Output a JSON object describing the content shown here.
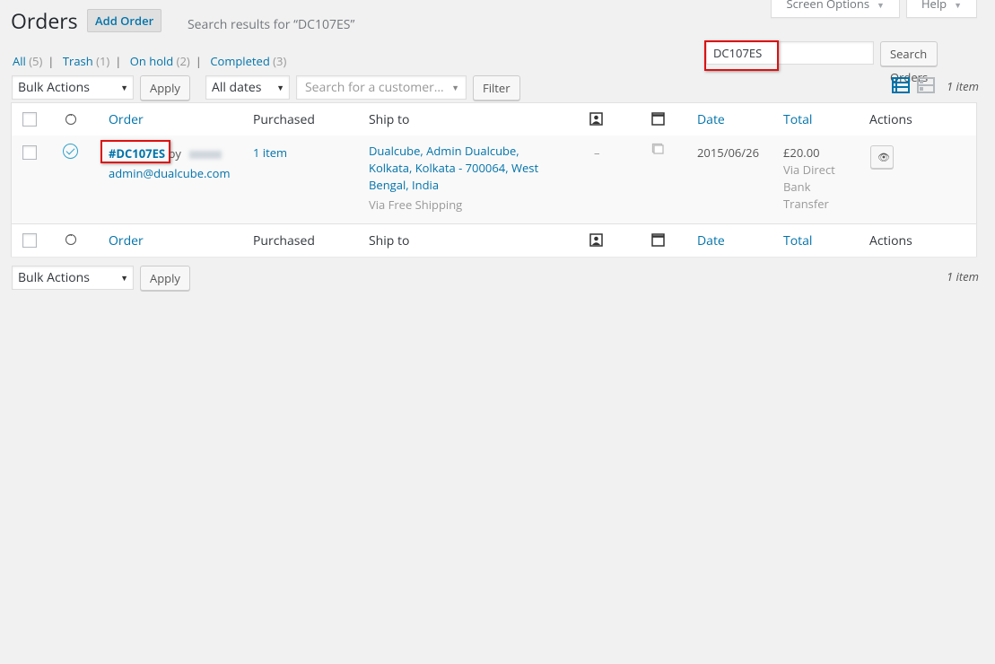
{
  "screen_meta": {
    "screen_options": "Screen Options",
    "help": "Help"
  },
  "header": {
    "title": "Orders",
    "add_order": "Add Order",
    "search_results": "Search results for “DC107ES”"
  },
  "filters": [
    {
      "label": "All",
      "count": "(5)"
    },
    {
      "label": "Trash",
      "count": "(1)"
    },
    {
      "label": "On hold",
      "count": "(2)"
    },
    {
      "label": "Completed",
      "count": "(3)"
    }
  ],
  "search": {
    "value": "DC107ES",
    "button": "Search Orders"
  },
  "top_nav": {
    "bulk_actions": "Bulk Actions",
    "apply": "Apply",
    "dates": "All dates",
    "customer_placeholder": "Search for a customer…",
    "filter": "Filter",
    "items_count": "1 item"
  },
  "columns": {
    "order": "Order",
    "purchased": "Purchased",
    "ship_to": "Ship to",
    "date": "Date",
    "total": "Total",
    "actions": "Actions"
  },
  "order_row": {
    "order_number": "#DC107ES",
    "by": "by",
    "email": "admin@dualcube.com",
    "purchased": "1 item",
    "ship_lines": [
      "Dualcube, Admin Dualcube,",
      "Kolkata, Kolkata - 700064, West",
      "Bengal, India"
    ],
    "ship_via": "Via Free Shipping",
    "note_dash": "–",
    "date": "2015/06/26",
    "total": "£20.00",
    "payment_lines": [
      "Via Direct",
      "Bank",
      "Transfer"
    ]
  },
  "bottom_nav": {
    "bulk_actions": "Bulk Actions",
    "apply": "Apply",
    "items_count": "1 item"
  },
  "colors": {
    "link": "#0073aa",
    "highlight": "#dd1111",
    "status": "#2ea2cc"
  }
}
